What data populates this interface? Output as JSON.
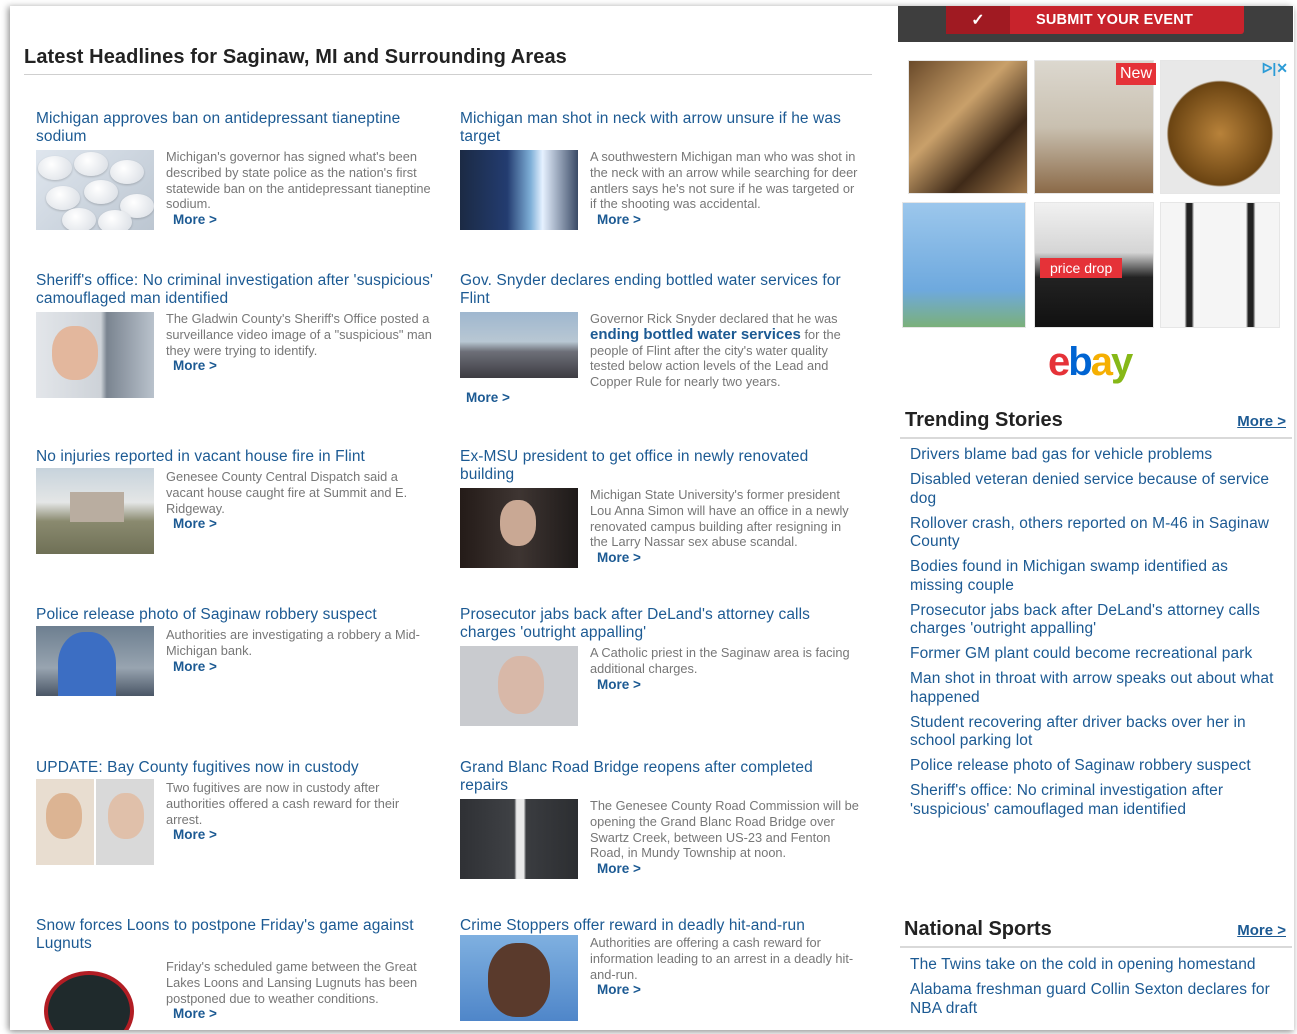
{
  "main": {
    "title": "Latest Headlines for Saginaw, MI and Surrounding Areas",
    "more_label": "More >",
    "stories": [
      {
        "headline": "Michigan approves ban on antidepressant tianeptine sodium",
        "summary": "Michigan's governor has signed what's been described by state police as the nation's first statewide ban on the antidepressant tianeptine sodium.",
        "thumb": "pills-photo"
      },
      {
        "headline": "Michigan man shot in neck with arrow unsure if he was target",
        "summary": "A southwestern Michigan man who was shot in the neck with an arrow while searching for deer antlers says he's not sure if he was targeted or if the shooting was accidental.",
        "thumb": "police-lights-photo"
      },
      {
        "headline": "Sheriff's office: No criminal investigation after 'suspicious' camouflaged man identified",
        "summary": "The Gladwin County's Sheriff's Office posted a surveillance video image of a \"suspicious\" man they were trying to identify.",
        "thumb": "surveillance-photo"
      },
      {
        "headline": "Gov. Snyder declares ending bottled water services for Flint",
        "summary_pre": "Governor Rick Snyder declared that he was",
        "summary_hl": "ending bottled water services",
        "summary_post": "for the people of Flint after the city's water quality tested below action levels of the Lead and Copper Rule for nearly two years.",
        "thumb": "water-distribution-photo"
      },
      {
        "headline": "No injuries reported in vacant house fire in Flint",
        "summary": "Genesee County Central Dispatch said a vacant house caught fire at Summit and E. Ridgeway.",
        "thumb": "house-photo"
      },
      {
        "headline": "Ex-MSU president to get office in newly renovated building",
        "summary": "Michigan State University's former president Lou Anna Simon will have an office in a newly renovated campus building after resigning in the Larry Nassar sex abuse scandal.",
        "thumb": "simon-photo"
      },
      {
        "headline": "Police release photo of Saginaw robbery suspect",
        "summary": "Authorities are investigating a robbery a Mid-Michigan bank.",
        "thumb": "robbery-suspect-photo"
      },
      {
        "headline": "Prosecutor jabs back after DeLand's attorney calls charges 'outright appalling'",
        "summary": "A Catholic priest in the Saginaw area is facing additional charges.",
        "thumb": "priest-mugshot"
      },
      {
        "headline": "UPDATE: Bay County fugitives now in custody",
        "summary": "Two fugitives are now in custody after authorities offered a cash reward for their arrest.",
        "thumb": "fugitives-photo"
      },
      {
        "headline": "Grand Blanc Road Bridge reopens after completed repairs",
        "summary": "The Genesee County Road Commission will be opening the Grand Blanc Road Bridge over Swartz Creek, between US-23 and Fenton Road, in Mundy Township at noon.",
        "thumb": "road-photo"
      },
      {
        "headline": "Snow forces Loons to postpone Friday's game against Lugnuts",
        "summary": "Friday's scheduled game between the Great Lakes Loons and Lansing Lugnuts has been postponed due to weather conditions.",
        "thumb": "loons-logo"
      },
      {
        "headline": "Crime Stoppers offer reward in deadly hit-and-run",
        "summary": "Authorities are offering a cash reward for information leading to an arrest in a deadly hit-and-run.",
        "thumb": "suspect-photo"
      }
    ]
  },
  "sidebar": {
    "submit_label": "SUBMIT YOUR EVENT",
    "check_icon": "✓",
    "ad": {
      "new_badge": "New",
      "price_drop": "price drop",
      "brand": [
        "e",
        "b",
        "a",
        "y"
      ],
      "choices": "ᐅ|✕"
    },
    "trending": {
      "title": "Trending Stories",
      "more": "More >",
      "items": [
        "Drivers blame bad gas for vehicle problems",
        "Disabled veteran denied service because of service dog",
        "Rollover crash, others reported on M-46 in Saginaw County",
        "Bodies found in Michigan swamp identified as missing couple",
        "Prosecutor jabs back after DeLand's attorney calls charges 'outright appalling'",
        "Former GM plant could become recreational park",
        "Man shot in throat with arrow speaks out about what happened",
        "Student recovering after driver backs over her in school parking lot",
        "Police release photo of Saginaw robbery suspect",
        "Sheriff's office: No criminal investigation after 'suspicious' camouflaged man identified"
      ]
    },
    "sports": {
      "title": "National Sports",
      "more": "More >",
      "items": [
        "The Twins take on the cold in opening homestand",
        "Alabama freshman guard Collin Sexton declares for NBA draft"
      ]
    }
  }
}
